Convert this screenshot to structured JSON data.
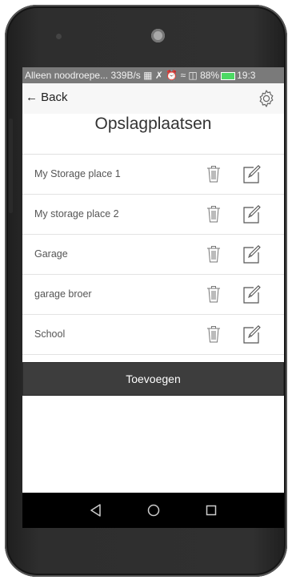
{
  "status_bar": {
    "carrier_text": "Alleen noodroepe...",
    "speed": "339B/s",
    "battery": "88%",
    "time": "19:3"
  },
  "nav": {
    "back_label": "← Back",
    "settings_icon": "gear-icon"
  },
  "page_title": "Opslagplaatsen",
  "storage_places": [
    {
      "name": "My Storage place 1"
    },
    {
      "name": "My storage place 2"
    },
    {
      "name": "Garage"
    },
    {
      "name": "garage broer"
    },
    {
      "name": "School"
    }
  ],
  "add_button_label": "Toevoegen",
  "system_nav": {
    "back_icon": "triangle-back-icon",
    "home_icon": "circle-home-icon",
    "recents_icon": "square-recents-icon"
  },
  "colors": {
    "status_bar": "#7a7a7a",
    "add_button": "#3d3d3d",
    "battery": "#4cd964"
  }
}
